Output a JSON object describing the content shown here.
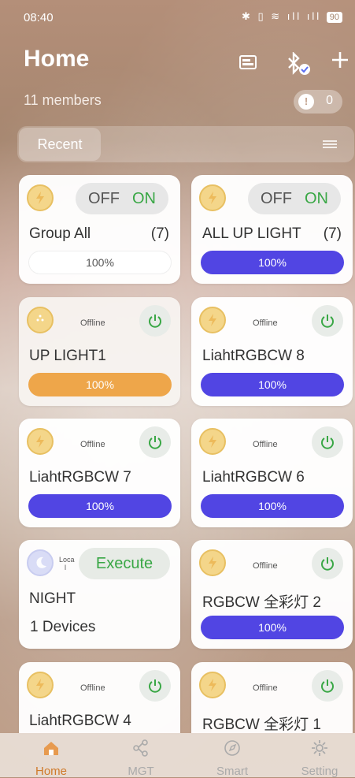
{
  "status": {
    "time": "08:40",
    "icons": "✱ ▯ ≋ ıll ıll",
    "battery": "90"
  },
  "header": {
    "title": "Home",
    "members": "11 members",
    "notifications": "0",
    "notif_dot": "!"
  },
  "recent": {
    "tab_label": "Recent"
  },
  "cards": [
    {
      "name": "Group All",
      "count": "(7)",
      "off": "OFF",
      "on": "ON",
      "bar": "100%"
    },
    {
      "name": "ALL UP LIGHT",
      "count": "(7)",
      "off": "OFF",
      "on": "ON",
      "bar": "100%"
    },
    {
      "name": "UP LIGHT1",
      "status": "Offline",
      "bar": "100%"
    },
    {
      "name": "LiahtRGBCW 8",
      "status": "Offline",
      "bar": "100%"
    },
    {
      "name": "LiahtRGBCW 7",
      "status": "Offline",
      "bar": "100%"
    },
    {
      "name": "LiahtRGBCW 6",
      "status": "Offline",
      "bar": "100%"
    },
    {
      "name": "NIGHT",
      "loca": "Loca l",
      "execute": "Execute",
      "devices": "1 Devices"
    },
    {
      "name": "RGBCW 全彩灯 2",
      "status": "Offline",
      "bar": "100%"
    },
    {
      "name": "LiahtRGBCW 4",
      "status": "Offline"
    },
    {
      "name": "RGBCW 全彩灯 1",
      "status": "Offline"
    }
  ],
  "tabbar": [
    {
      "label": "Home",
      "icon": "home-icon"
    },
    {
      "label": "MGT",
      "icon": "share-icon"
    },
    {
      "label": "Smart",
      "icon": "compass-icon"
    },
    {
      "label": "Setting",
      "icon": "gear-icon"
    }
  ],
  "colors": {
    "accent_blue": "#5145e3",
    "accent_orange": "#eea64a",
    "on_green": "#39a745",
    "active_tab": "#d07a2a"
  }
}
